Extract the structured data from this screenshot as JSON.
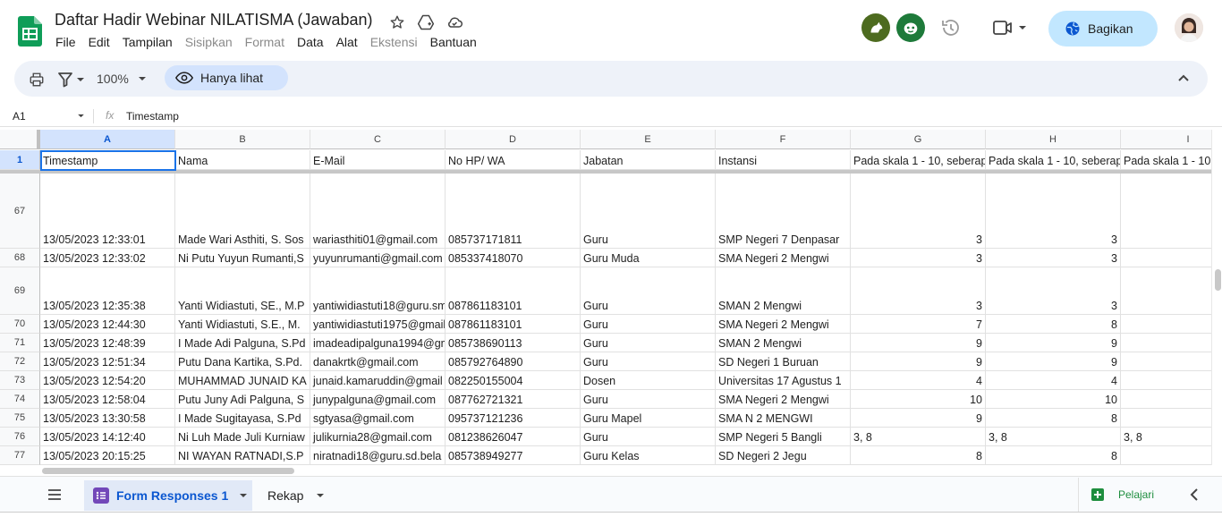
{
  "doc": {
    "title": "Daftar Hadir Webinar NILATISMA (Jawaban)"
  },
  "menu": [
    "File",
    "Edit",
    "Tampilan",
    "Sisipkan",
    "Format",
    "Data",
    "Alat",
    "Ekstensi",
    "Bantuan"
  ],
  "menu_disabled": [
    false,
    false,
    false,
    true,
    true,
    false,
    false,
    true,
    false
  ],
  "share": {
    "label": "Bagikan"
  },
  "toolbar": {
    "zoom": "100%",
    "view_only": "Hanya lihat"
  },
  "formula": {
    "namebox": "A1",
    "fx": "fx",
    "value": "Timestamp"
  },
  "grid": {
    "columns": [
      "A",
      "B",
      "C",
      "D",
      "E",
      "F",
      "G",
      "H",
      "I"
    ],
    "header_row": {
      "num": "1",
      "cells": [
        "Timestamp",
        "Nama",
        "E-Mail",
        "No HP/ WA",
        "Jabatan",
        "Instansi",
        "Pada skala 1 - 10, seberapa",
        "Pada skala 1 - 10, seberapa",
        "Pada skala 1 - 10"
      ]
    },
    "rows": [
      {
        "num": "67",
        "cells": [
          "13/05/2023 12:33:01",
          "Made Wari Asthiti, S. Sos",
          "wariasthiti01@gmail.com",
          "085737171811",
          "Guru",
          "SMP Negeri 7 Denpasar",
          "3",
          "3",
          ""
        ]
      },
      {
        "num": "68",
        "cells": [
          "13/05/2023 12:33:02",
          "Ni Putu Yuyun Rumanti,S",
          "yuyunrumanti@gmail.com",
          "085337418070",
          "Guru Muda",
          "SMA Negeri 2 Mengwi",
          "3",
          "3",
          ""
        ]
      },
      {
        "num": "69",
        "cells": [
          "13/05/2023 12:35:38",
          "Yanti Widiastuti, SE., M.P",
          "yantiwidiastuti18@guru.sma",
          "087861183101",
          "Guru",
          "SMAN 2 Mengwi",
          "3",
          "3",
          ""
        ]
      },
      {
        "num": "70",
        "cells": [
          "13/05/2023 12:44:30",
          "Yanti Widiastuti, S.E., M.",
          "yantiwidiastuti1975@gmail",
          "087861183101",
          "Guru",
          "SMA Negeri 2 Mengwi",
          "7",
          "8",
          ""
        ]
      },
      {
        "num": "71",
        "cells": [
          "13/05/2023 12:48:39",
          "I Made Adi Palguna, S.Pd",
          "imadeadipalguna1994@gm",
          "085738690113",
          "Guru",
          "SMAN 2 Mengwi",
          "9",
          "9",
          ""
        ]
      },
      {
        "num": "72",
        "cells": [
          "13/05/2023 12:51:34",
          "Putu Dana Kartika, S.Pd.",
          "danakrtk@gmail.com",
          "085792764890",
          "Guru",
          "SD Negeri 1 Buruan",
          "9",
          "9",
          ""
        ]
      },
      {
        "num": "73",
        "cells": [
          "13/05/2023 12:54:20",
          "MUHAMMAD JUNAID KA",
          "junaid.kamaruddin@gmail",
          "082250155004",
          "Dosen",
          "Universitas 17 Agustus 1",
          "4",
          "4",
          ""
        ]
      },
      {
        "num": "74",
        "cells": [
          "13/05/2023 12:58:04",
          "Putu Juny Adi Palguna, S",
          "junypalguna@gmail.com",
          "087762721321",
          "Guru",
          "SMA Negeri 2 Mengwi",
          "10",
          "10",
          ""
        ]
      },
      {
        "num": "75",
        "cells": [
          "13/05/2023 13:30:58",
          "I Made Sugitayasa, S.Pd",
          "sgtyasa@gmail.com",
          "095737121236",
          "Guru Mapel",
          "SMA N 2 MENGWI",
          "9",
          "8",
          ""
        ]
      },
      {
        "num": "76",
        "cells": [
          "13/05/2023 14:12:40",
          "Ni Luh Made Juli Kurniaw",
          "julikurnia28@gmail.com",
          "081238626047",
          "Guru",
          "SMP Negeri 5 Bangli",
          "3, 8",
          "3, 8",
          "3, 8"
        ]
      },
      {
        "num": "77",
        "cells": [
          "13/05/2023 20:15:25",
          "NI WAYAN RATNADI,S.P",
          "niratnadi18@guru.sd.bela",
          "085738949277",
          "Guru Kelas",
          "SD Negeri 2 Jegu",
          "8",
          "8",
          ""
        ]
      }
    ]
  },
  "sheets": {
    "active": "Form Responses 1",
    "other": "Rekap"
  },
  "explore": {
    "label": "Pelajari"
  },
  "colors": {
    "accent": "#0b57d0",
    "share_bg": "#c2e7ff",
    "sheets_green": "#1e8e3e",
    "selection": "#1a73e8"
  }
}
